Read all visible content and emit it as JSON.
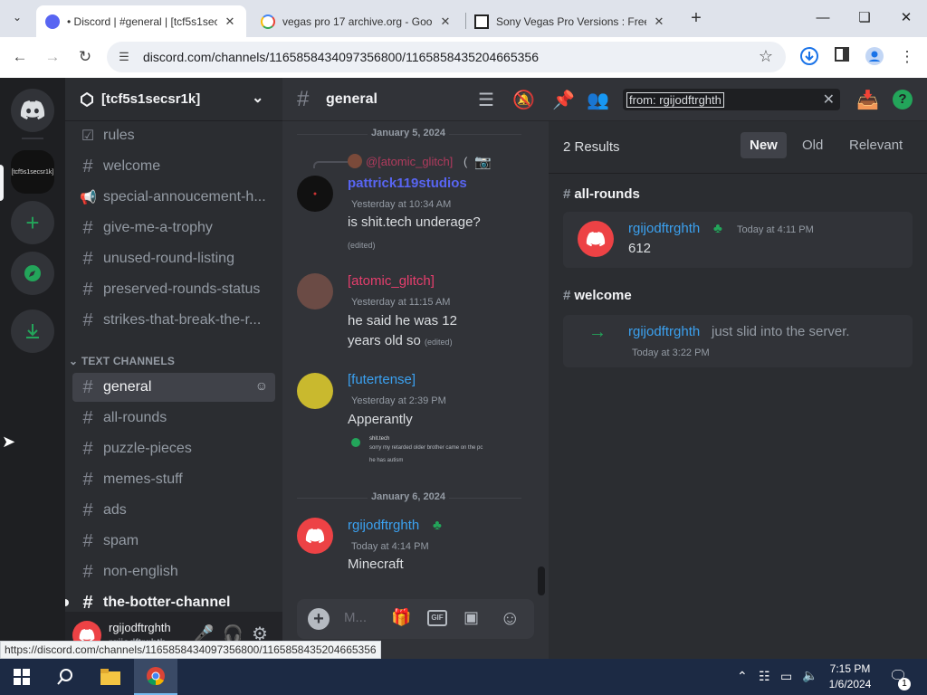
{
  "browser": {
    "tabs": [
      {
        "title": "• Discord | #general | [tcf5s1sec",
        "close": "✕",
        "active": true
      },
      {
        "title": "vegas pro 17 archive.org - Goo",
        "close": "✕",
        "active": false
      },
      {
        "title": "Sony Vegas Pro Versions : Free",
        "close": "✕",
        "active": false
      }
    ],
    "new_tab": "+",
    "url": "discord.com/channels/1165858434097356800/1165858435204665356",
    "status_url": "https://discord.com/channels/1165858434097356800/1165858435204665356"
  },
  "server": {
    "name": "[tcf5s1secsr1k]",
    "icon_label": "[tcf5s1secsr1k]"
  },
  "channels": {
    "top": [
      {
        "name": "rules",
        "icon": "rules-icon"
      },
      {
        "name": "welcome",
        "icon": "hash-icon"
      },
      {
        "name": "special-annoucement-h...",
        "icon": "announcement-icon"
      },
      {
        "name": "give-me-a-trophy",
        "icon": "hash-icon"
      },
      {
        "name": "unused-round-listing",
        "icon": "hash-icon"
      },
      {
        "name": "preserved-rounds-status",
        "icon": "hash-icon"
      },
      {
        "name": "strikes-that-break-the-r...",
        "icon": "hash-icon"
      }
    ],
    "category": "TEXT CHANNELS",
    "text": [
      {
        "name": "general",
        "selected": true
      },
      {
        "name": "all-rounds"
      },
      {
        "name": "puzzle-pieces"
      },
      {
        "name": "memes-stuff"
      },
      {
        "name": "ads"
      },
      {
        "name": "spam"
      },
      {
        "name": "non-english"
      },
      {
        "name": "the-botter-channel",
        "unread": true
      }
    ]
  },
  "user": {
    "name": "rgijodftrghth",
    "sub": "rgijodftrghth"
  },
  "chat": {
    "channel": "general",
    "reply_name": "@[atomic_glitch]",
    "reply_suffix": "(",
    "date1": "January 5, 2024",
    "date2": "January 6, 2024",
    "messages": [
      {
        "author": "pattrick119studios",
        "time": "Yesterday at 10:34 AM",
        "text": "is shit.tech underage?",
        "edited": "(edited)",
        "color": "#5865f2"
      },
      {
        "author": "[atomic_glitch]",
        "time": "Yesterday at 11:15 AM",
        "text1": "he said he was 12",
        "text2": "years old so",
        "edited": "(edited)",
        "color": "#e63e6d"
      },
      {
        "author": "[futertense]",
        "time": "Yesterday at 2:39 PM",
        "text": "Apperantly",
        "color": "#3ba1f0"
      },
      {
        "author": "rgijodftrghth",
        "time": "Today at 4:14 PM",
        "text": "Minecraft",
        "color": "#3ba1f0"
      }
    ],
    "embed": {
      "author": "shit.tech",
      "line1": "sorry my retarded older brother came on the pc",
      "line2": "he has autism"
    },
    "composer_placeholder": "M..."
  },
  "search": {
    "query": "from: rgijodftrghth",
    "results_count": "2 Results",
    "sort_tabs": [
      "New",
      "Old",
      "Relevant"
    ],
    "groups": [
      {
        "channel": "all-rounds",
        "author": "rgijodftrghth",
        "time": "Today at 4:11 PM",
        "text": "612"
      },
      {
        "channel": "welcome",
        "author": "rgijodftrghth",
        "text": "just slid into the server.",
        "time": "Today at 3:22 PM"
      }
    ]
  },
  "taskbar": {
    "time": "7:15 PM",
    "date": "1/6/2024",
    "notif": "1"
  },
  "colors": {
    "blurple": "#5865f2",
    "green": "#23a55a",
    "link": "#3ba1f0"
  }
}
